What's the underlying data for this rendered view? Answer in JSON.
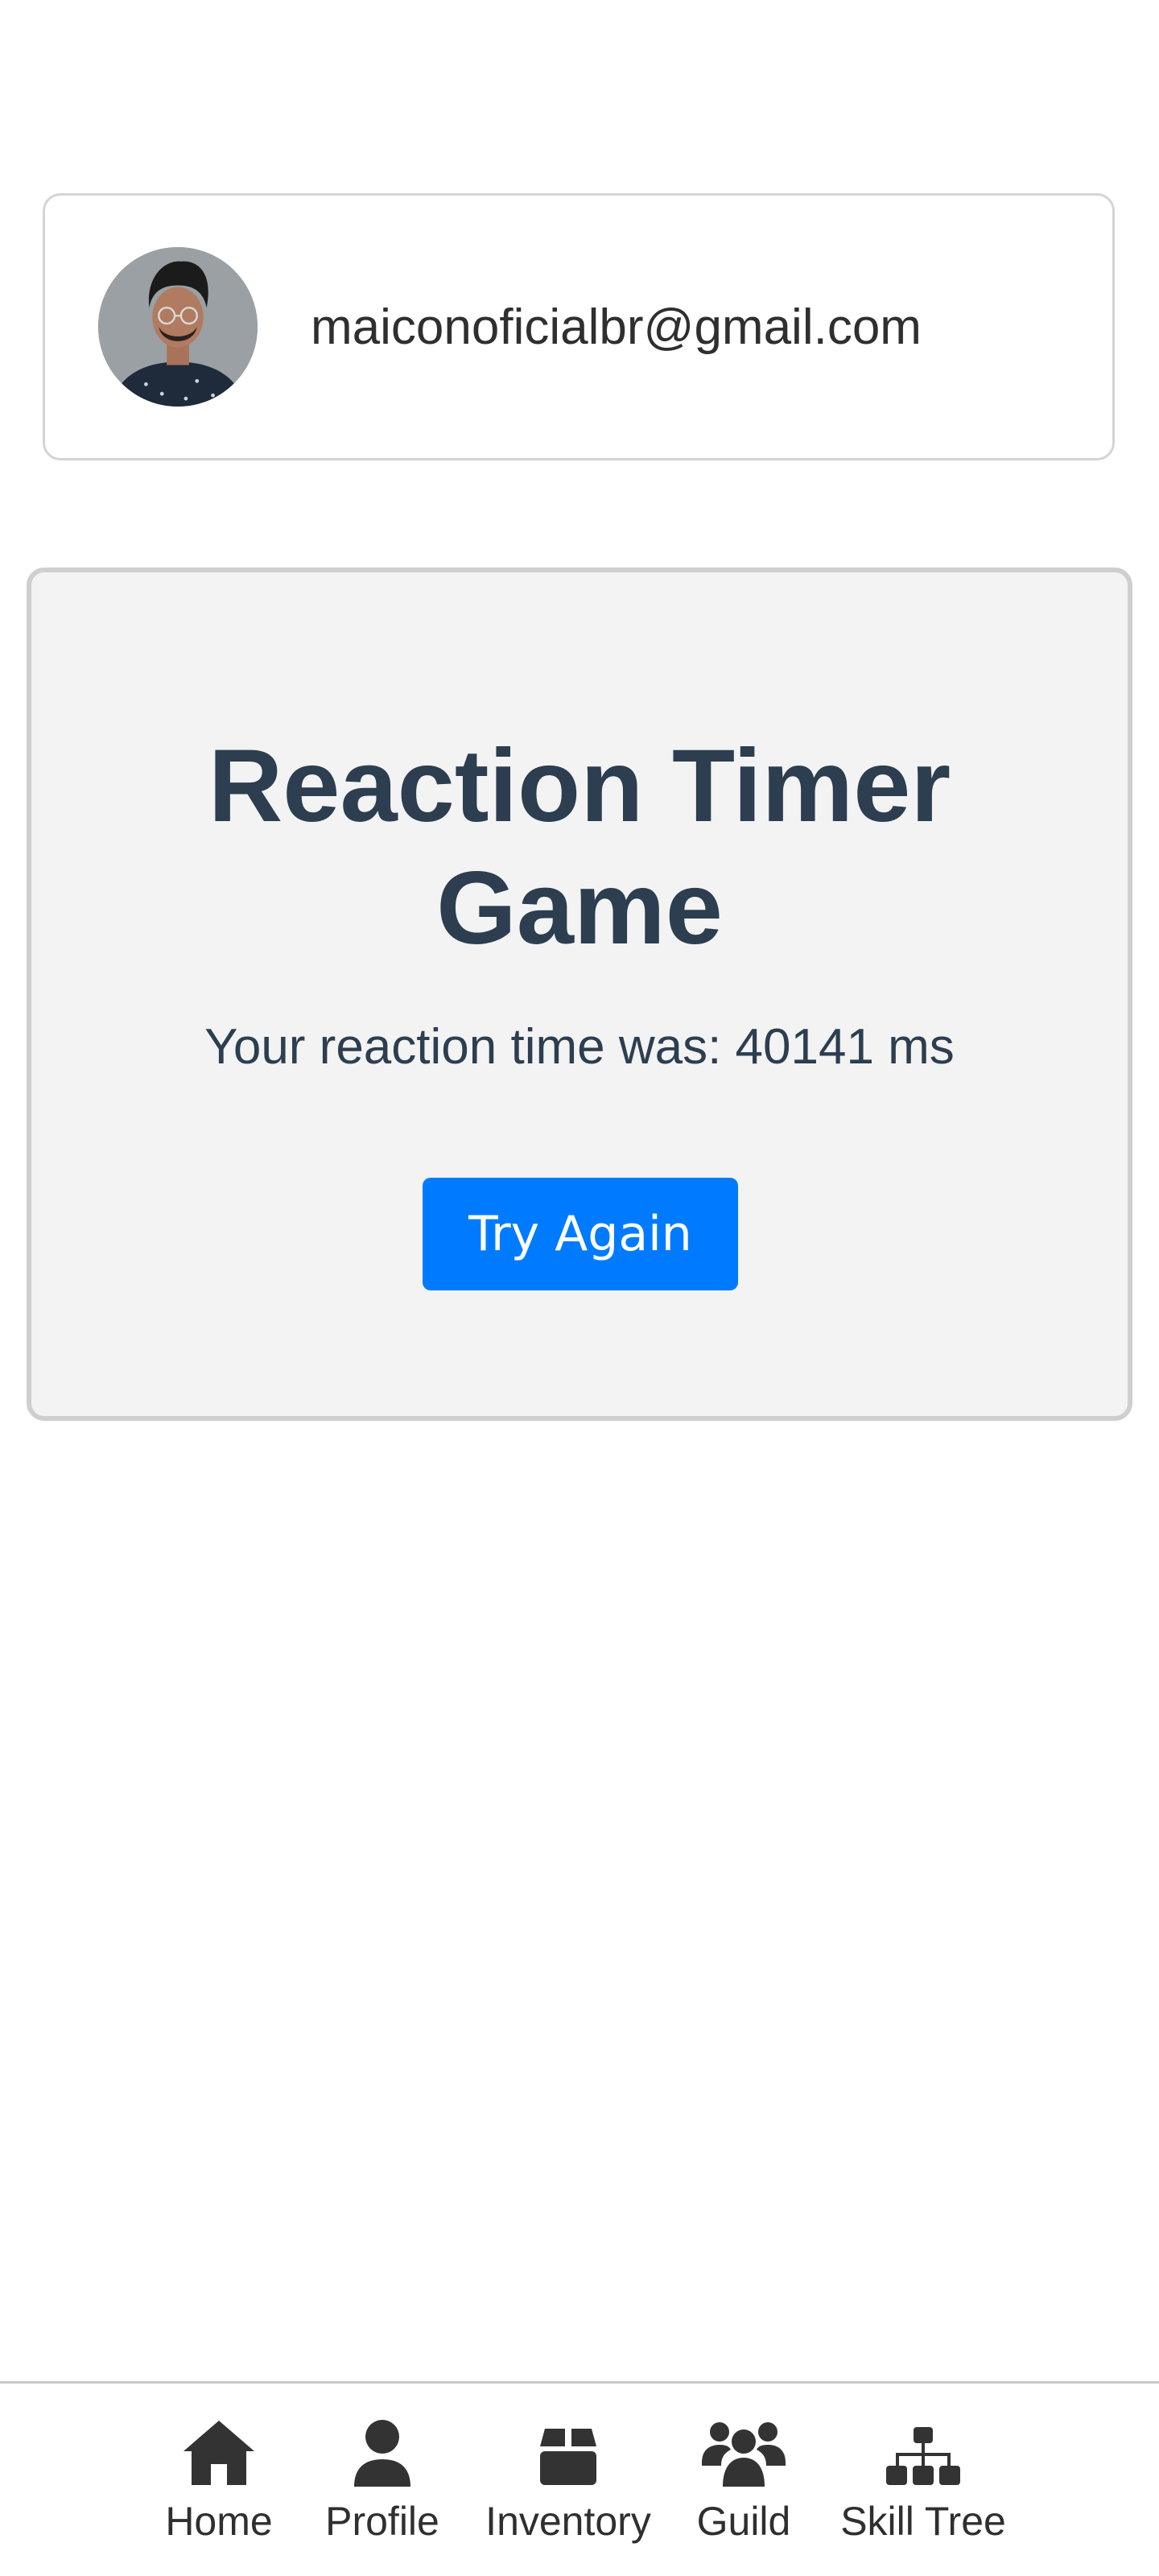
{
  "user": {
    "email": "maiconoficialbr@gmail.com"
  },
  "game": {
    "title": "Reaction Timer Game",
    "result_text": "Your reaction time was: 40141 ms",
    "reaction_time_ms": 40141,
    "try_again_label": "Try Again"
  },
  "nav": {
    "items": [
      {
        "label": "Home",
        "icon": "home-icon"
      },
      {
        "label": "Profile",
        "icon": "user-icon"
      },
      {
        "label": "Inventory",
        "icon": "box-icon"
      },
      {
        "label": "Guild",
        "icon": "users-icon"
      },
      {
        "label": "Skill Tree",
        "icon": "sitemap-icon"
      }
    ]
  },
  "colors": {
    "primary_button": "#007bff",
    "text_dark": "#2c3e50",
    "card_background": "#f3f3f3"
  }
}
